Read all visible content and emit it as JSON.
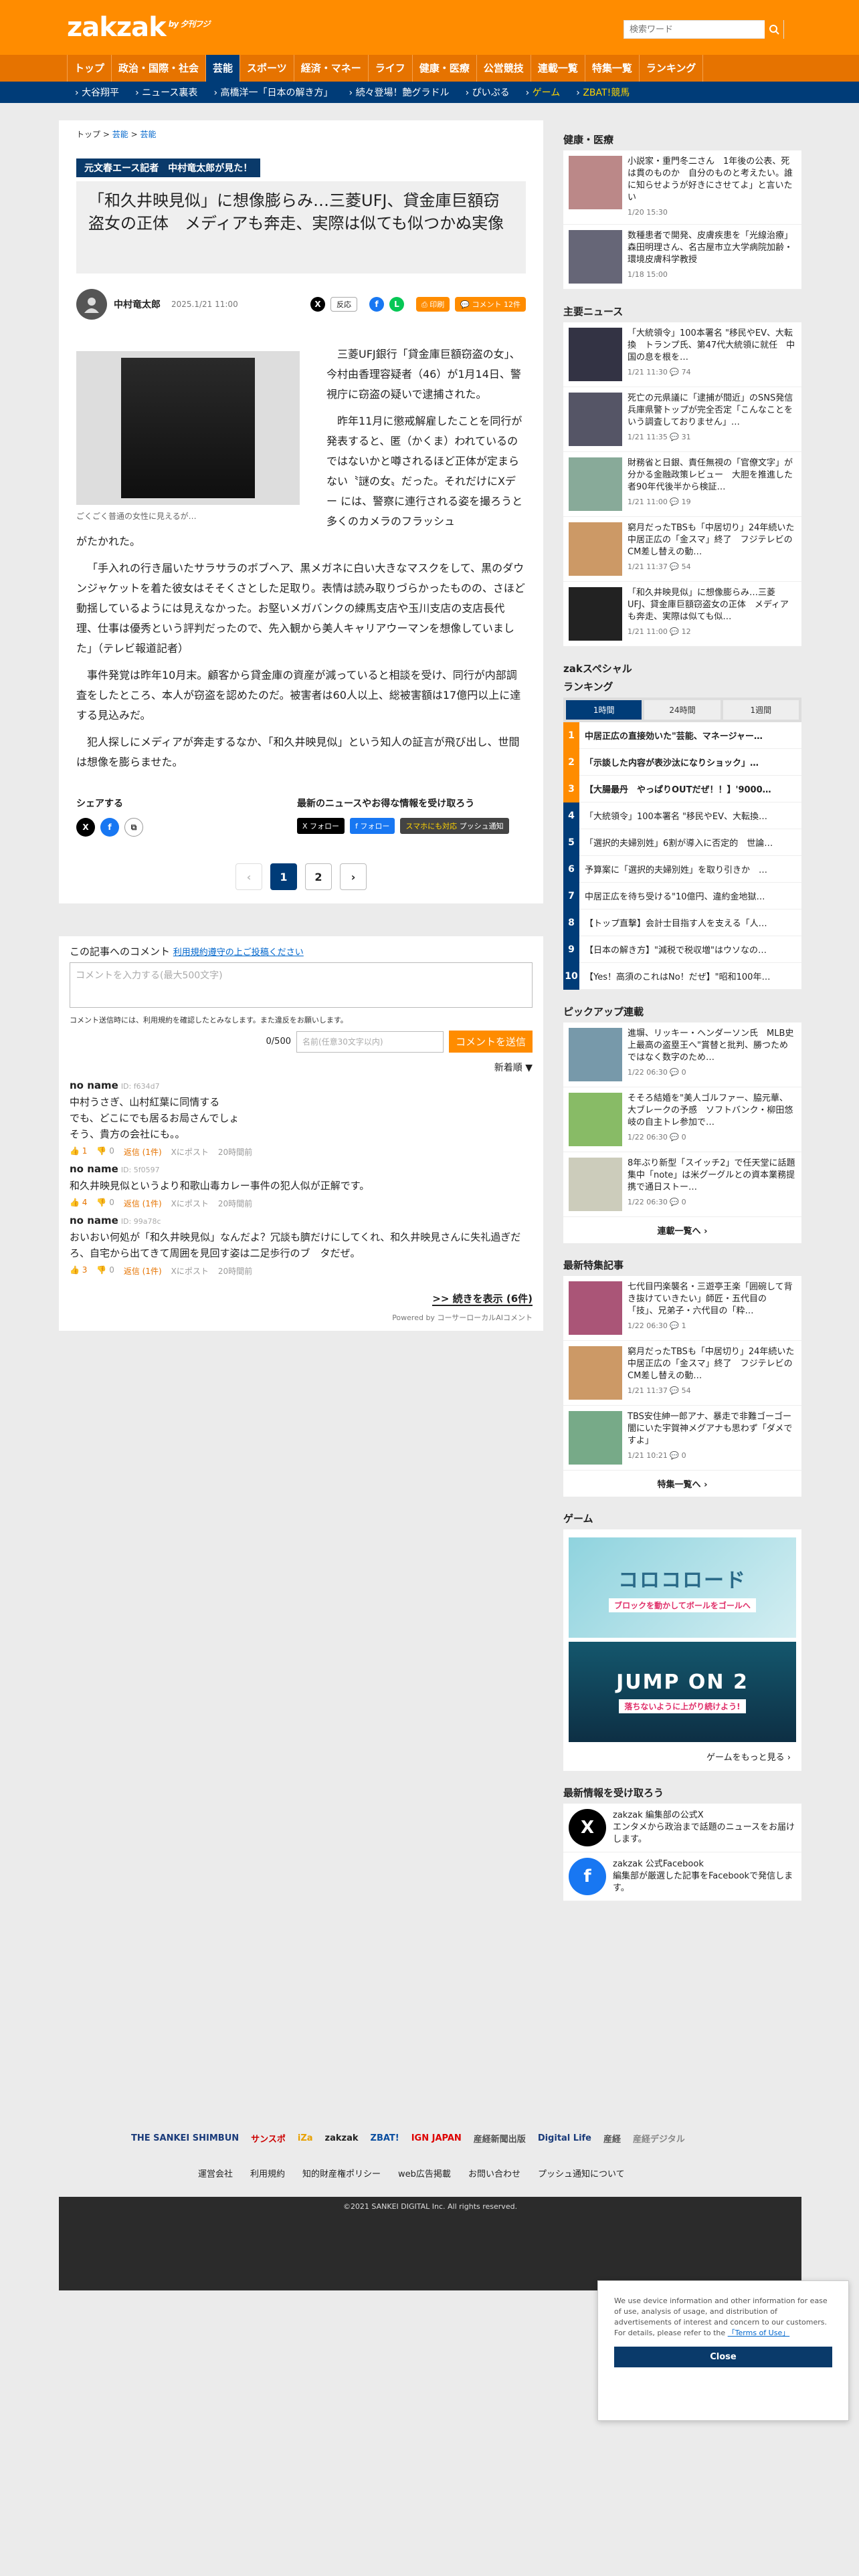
{
  "header": {
    "logo_main": "zakzak",
    "logo_sub": "by 夕刊フジ",
    "search_placeholder": "検索ワード"
  },
  "nav": [
    "トップ",
    "政治・国際・社会",
    "芸能",
    "スポーツ",
    "経済・マネー",
    "ライフ",
    "健康・医療",
    "公営競技",
    "連載一覧",
    "特集一覧",
    "ランキング"
  ],
  "subnav": [
    "大谷翔平",
    "ニュース裏表",
    "高橋洋一「日本の解き方」",
    "続々登場！艶グラドル",
    "ぴいぷる",
    "ゲーム",
    "ZBAT!競馬"
  ],
  "breadcrumb": {
    "home": "トップ",
    "sep": ">",
    "section": "芸能",
    "current": "芸能"
  },
  "article": {
    "kicker": "元文春エース記者　中村竜太郎が見た！",
    "title": "「和久井映見似」に想像膨らみ…三菱UFJ、貸金庫巨額窃盗女の正体　メディアも奔走、実際は似ても似つかぬ実像",
    "author": "中村竜太郎",
    "date": "2025.1/21 11:00",
    "pill_label": "反応",
    "print_label": "印刷",
    "comment_label": "コメント 12件",
    "photo_caption": "ごくごく普通の女性に見えるが…",
    "p1": "三菱UFJ銀行「貸金庫巨額窃盗の女」、今村由香理容疑者（46）が1月14日、警視庁に窃盗の疑いで逮捕された。",
    "p2": "昨年11月に懲戒解雇したことを同行が発表すると、匿（かくま）われているのではないかと噂されるほど正体が定まらない〝謎の女〟だった。それだけにXデー には、警察に連行される姿を撮ろうと多くのカメラのフラッシュ",
    "p2b": "がたかれた。",
    "p3": "「手入れの行き届いたサラサラのボブヘア、黒メガネに白い大きなマスクをして、黒のダウンジャケットを着た彼女はそそくさとした足取り。表情は読み取りづらかったものの、さほど動揺しているようには見えなかった。お堅いメガバンクの練馬支店や玉川支店の支店長代理、仕事は優秀という評判だったので、先入観から美人キャリアウーマンを想像していました」（テレビ報道記者）",
    "p4": "事件発覚は昨年10月末。顧客から貸金庫の資産が減っていると相談を受け、同行が内部調査をしたところ、本人が窃盗を認めたのだ。被害者は60人以上、総被害額は17億円以上に達する見込みだ。",
    "p5": "犯人探しにメディアが奔走するなか、「和久井映見似」という知人の証言が飛び出し、世間は想像を膨らませた。",
    "share_label": "シェアする",
    "follow_label": "最新のニュースやお得な情報を受け取ろう",
    "follow_x": "フォロー",
    "follow_fb": "フォロー",
    "push_label": "スマホにも対応",
    "push_label2": "プッシュ通知",
    "pages": [
      "1",
      "2"
    ]
  },
  "comments": {
    "header": "この記事へのコメント",
    "terms_link": "利用規約遵守の上ご投稿ください",
    "placeholder": "コメントを入力する(最大500文字)",
    "note": "コメント送信時には、利用規約を確認したとみなします。また違反をお願いします。",
    "count": "0/500",
    "name_placeholder": "名前(任意30文字以内)",
    "send": "コメントを送信",
    "sort": "新着順 ▼",
    "items": [
      {
        "name": "no name",
        "id": "ID: f634d7",
        "text": "中村うさぎ、山村紅葉に同情する\nでも、どこにでも居るお局さんでしょ\nそう、貴方の会社にも。。",
        "likes": "1",
        "dislikes": "0",
        "reply": "返信 (1件)",
        "xpost": "Xにポスト",
        "ago": "20時間前"
      },
      {
        "name": "no name",
        "id": "ID: 5f0597",
        "text": "和久井映見似というより和歌山毒カレー事件の犯人似が正解です。",
        "likes": "4",
        "dislikes": "0",
        "reply": "返信 (1件)",
        "xpost": "Xにポスト",
        "ago": "20時間前"
      },
      {
        "name": "no name",
        "id": "ID: 99a78c",
        "text": "おいおい何処が「和久井映見似」なんだよ？冗談も臍だけにしてくれ、和久井映見さんに失礼過ぎだろ、自宅から出てきて周囲を見回す姿は二足歩行のブ　タだぜ。",
        "likes": "3",
        "dislikes": "0",
        "reply": "返信 (1件)",
        "xpost": "Xにポスト",
        "ago": "20時間前"
      }
    ],
    "more": ">> 続きを表示 (6件)",
    "powered": "Powered by コーサーローカルAIコメント"
  },
  "sidebar": {
    "health_title": "健康・医療",
    "health": [
      {
        "text": "小説家・重門冬二さん　1年後の公表、死は貫のものか　自分のものと考えたい。誰に知らせようが好きにさせてよ」と言いたい",
        "meta": "1/20 15:30"
      },
      {
        "text": "数種患者で開発、皮膚疾患を「光線治療」森田明理さん、名古屋市立大学病院加齢・環境皮膚科学教授",
        "meta": "1/18 15:00"
      }
    ],
    "main_title": "主要ニュース",
    "main": [
      {
        "text": "「大統領令」100本署名 \"移民やEV、大転換　トランプ氏、第47代大統領に就任　中国の息を根を…",
        "meta": "1/21 11:30",
        "c": "74"
      },
      {
        "text": "死亡の元県議に「逮捕が間近」のSNS発信　兵庫県警トップが完全否定「こんなことをいう調査しておりません」…",
        "meta": "1/21 11:35",
        "c": "31"
      },
      {
        "text": "財務省と日銀、責任無視の「官僚文字」が分かる金融政策レビュー　大胆を推進した者90年代後半から検証…",
        "meta": "1/21 11:00",
        "c": "19"
      },
      {
        "text": "窮月だったTBSも「中居切り」24年続いた中居正広の「金スマ」終了　フジテレビのCM差し替えの動…",
        "meta": "1/21 11:37",
        "c": "54"
      },
      {
        "text": "「和久井映見似」に想像膨らみ…三菱UFJ、貸金庫巨額窃盗女の正体　メディアも奔走、実際は似ても似…",
        "meta": "1/21 11:00",
        "c": "12"
      }
    ],
    "special_title": "zakスペシャル",
    "ranking_title": "ランキング",
    "ranking_tabs": [
      "1時間",
      "24時間",
      "1週間"
    ],
    "ranking": [
      "中居正広の直接効いた\"芸能、マネージャー…",
      "「示談した内容が表沙汰になりショック」…",
      "【大腸最丹　やっぱりOUTだぜ！！】'9000…",
      "「大統領令」100本署名 \"移民やEV、大転換…",
      "「選択的夫婦別姓」6割が導入に否定的　世論…",
      "予算案に「選択的夫婦別姓」を取り引きか　…",
      "中居正広を待ち受ける\"10億円、違約金地獄…",
      "【トップ直撃】会計士目指す人を支える「人…",
      "【日本の解き方】\"減税で税収増\"はウソなの…",
      "【Yes！高須のこれはNo！だぜ】\"昭和100年…"
    ],
    "pickup_title": "ピックアップ連載",
    "pickup": [
      {
        "text": "進塀、リッキー・ヘンダーソン氏　MLB史上最高の盗塁王へ\"賞替と批判、勝つためではなく数字のため…",
        "meta": "1/22 06:30",
        "c": "0"
      },
      {
        "text": "そそろ結婚を\"美人ゴルファー、脇元華、大ブレークの予感　ソフトバンク・柳田悠岐の自主トレ参加で…",
        "meta": "1/22 06:30",
        "c": "0"
      },
      {
        "text": "8年ぶり新型「スイッチ2」で任天堂に話題集中「note」は米グーグルとの資本業務提携で通日ストー…",
        "meta": "1/22 06:30",
        "c": "0"
      }
    ],
    "pickup_more": "連載一覧へ",
    "feature_title": "最新特集記事",
    "feature": [
      {
        "text": "七代目円楽襲名・三遊亭王楽「囲碗して背き抜けていきたい」師匠・五代目の「技」、兄弟子・六代目の「粋…",
        "meta": "1/22 06:30",
        "c": "1"
      },
      {
        "text": "窮月だったTBSも「中居切り」24年続いた中居正広の「金スマ」終了　フジテレビのCM差し替えの動…",
        "meta": "1/21 11:37",
        "c": "54"
      },
      {
        "text": "TBS安住紳一郎アナ、暴走で非難ゴーゴー　闇にいた宇賀神メグアナも思わず「ダメですよ」",
        "meta": "1/21 10:21",
        "c": "0"
      }
    ],
    "feature_more": "特集一覧へ",
    "game_title": "ゲーム",
    "game1_title": "コロコロード",
    "game1_sub": "ブロックを動かしてボールをゴールへ",
    "game2_title": "JUMP ON 2",
    "game2_sub": "落ちないように上がり続けよう!",
    "game_more": "ゲームをもっと見る",
    "receive_title": "最新情報を受け取ろう",
    "x_title": "zakzak 編集部の公式X",
    "x_text": "エンタメから政治まで話題のニュースをお届けします。",
    "fb_title": "zakzak 公式Facebook",
    "fb_text": "編集部が厳選した記事をFacebookで発信します。"
  },
  "footer": {
    "brands": [
      "THE SANKEI SHIMBUN",
      "サンスポ",
      "iZa",
      "zakzak",
      "ZBAT!",
      "IGN JAPAN",
      "産経新聞出版",
      "Digital Life",
      "産経",
      "産経デジタル"
    ],
    "links": [
      "運営会社",
      "利用規約",
      "知的財産権ポリシー",
      "web広告掲載",
      "お問い合わせ",
      "プッシュ通知について"
    ],
    "copyright": "©2021 SANKEI DIGITAL Inc. All rights reserved."
  },
  "cookie": {
    "text": "We use device information and other information for ease of use, analysis of usage, and distribution of advertisements of interest and concern to our customers. For details, please refer to the",
    "link": "「Terms of Use」",
    "close": "Close"
  }
}
